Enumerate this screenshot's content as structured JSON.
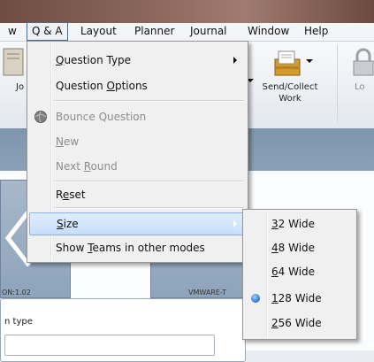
{
  "menubar": {
    "items": [
      {
        "label": "w"
      },
      {
        "label": "Q & A"
      },
      {
        "label": "Layout"
      },
      {
        "label": "Planner"
      },
      {
        "label": "Journal"
      },
      {
        "label": "Window"
      },
      {
        "label": "Help"
      }
    ]
  },
  "ribbon": {
    "send_collect_line1": "Send/Collect",
    "send_collect_line2": "Work",
    "left_partial": "Jo",
    "right_partial": "Lo"
  },
  "panels": {
    "left_caption": "ON:1.02",
    "right_caption": "VMWARE-T",
    "type_label": "n type"
  },
  "qa_menu": {
    "items": [
      {
        "pre": "",
        "u": "Q",
        "post": "uestion Type",
        "disabled": false,
        "submenu": true
      },
      {
        "pre": "Question ",
        "u": "O",
        "post": "ptions",
        "disabled": false,
        "submenu": false
      },
      {
        "pre": "Bounce Question",
        "u": "",
        "post": "",
        "disabled": true,
        "submenu": false,
        "icon": "bounce-icon"
      },
      {
        "pre": "",
        "u": "N",
        "post": "ew",
        "disabled": true,
        "submenu": false
      },
      {
        "pre": "Next ",
        "u": "R",
        "post": "ound",
        "disabled": true,
        "submenu": false
      },
      {
        "pre": "R",
        "u": "e",
        "post": "set",
        "disabled": false,
        "submenu": false
      },
      {
        "pre": "",
        "u": "S",
        "post": "ize",
        "disabled": false,
        "submenu": true,
        "highlighted": true
      },
      {
        "pre": "Show ",
        "u": "T",
        "post": "eams in other modes",
        "disabled": false,
        "submenu": false
      }
    ]
  },
  "size_menu": {
    "items": [
      {
        "u": "3",
        "post": "2 Wide",
        "selected": false
      },
      {
        "u": "4",
        "post": "8 Wide",
        "selected": false
      },
      {
        "u": "6",
        "post": "4 Wide",
        "selected": false
      },
      {
        "u": "1",
        "post": "28 Wide",
        "selected": true
      },
      {
        "u": "2",
        "post": "56 Wide",
        "selected": false
      }
    ]
  },
  "colors": {
    "highlight": "#c6defa",
    "radio": "#2f7fd6"
  }
}
